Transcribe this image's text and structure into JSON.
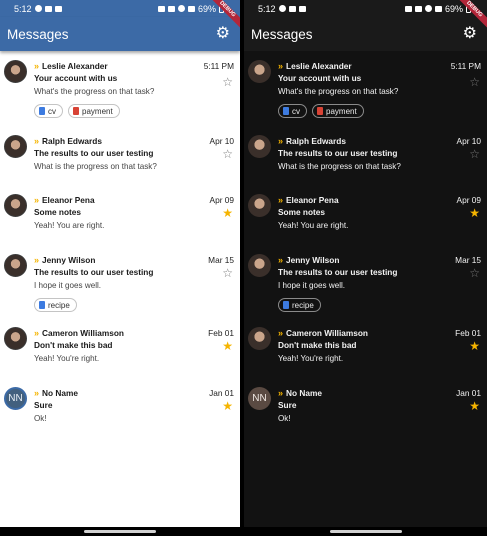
{
  "status": {
    "time": "5:12",
    "battery": "69%",
    "debug_banner": "DEBUG"
  },
  "appbar": {
    "title": "Messages",
    "settings_icon": "gear-icon"
  },
  "colors": {
    "primary": "#3c6aa6",
    "star": "#f5b400",
    "dark_bg": "#121212"
  },
  "messages": [
    {
      "sender": "Leslie Alexander",
      "date": "5:11 PM",
      "subject": "Your account with us",
      "preview": "What's the progress on that task?",
      "starred": false,
      "avatar": "photo",
      "attachments": [
        {
          "name": "cv",
          "icon": "file-blue"
        },
        {
          "name": "payment",
          "icon": "file-red"
        }
      ]
    },
    {
      "sender": "Ralph Edwards",
      "date": "Apr 10",
      "subject": "The results to our user testing",
      "preview": "What is the progress on that task?",
      "starred": false,
      "avatar": "photo",
      "attachments": []
    },
    {
      "sender": "Eleanor Pena",
      "date": "Apr 09",
      "subject": "Some notes",
      "preview": "Yeah! You are right.",
      "starred": true,
      "avatar": "photo",
      "attachments": []
    },
    {
      "sender": "Jenny Wilson",
      "date": "Mar 15",
      "subject": "The results to our user testing",
      "preview": "I hope it goes well.",
      "starred": false,
      "avatar": "photo",
      "attachments": [
        {
          "name": "recipe",
          "icon": "file-blue"
        }
      ]
    },
    {
      "sender": "Cameron Williamson",
      "date": "Feb 01",
      "subject": "Don't make this bad",
      "preview": "Yeah! You're right.",
      "starred": true,
      "avatar": "photo",
      "attachments": []
    },
    {
      "sender": "No Name",
      "date": "Jan 01",
      "subject": "Sure",
      "preview": "Ok!",
      "starred": true,
      "avatar": "NN",
      "attachments": []
    }
  ]
}
